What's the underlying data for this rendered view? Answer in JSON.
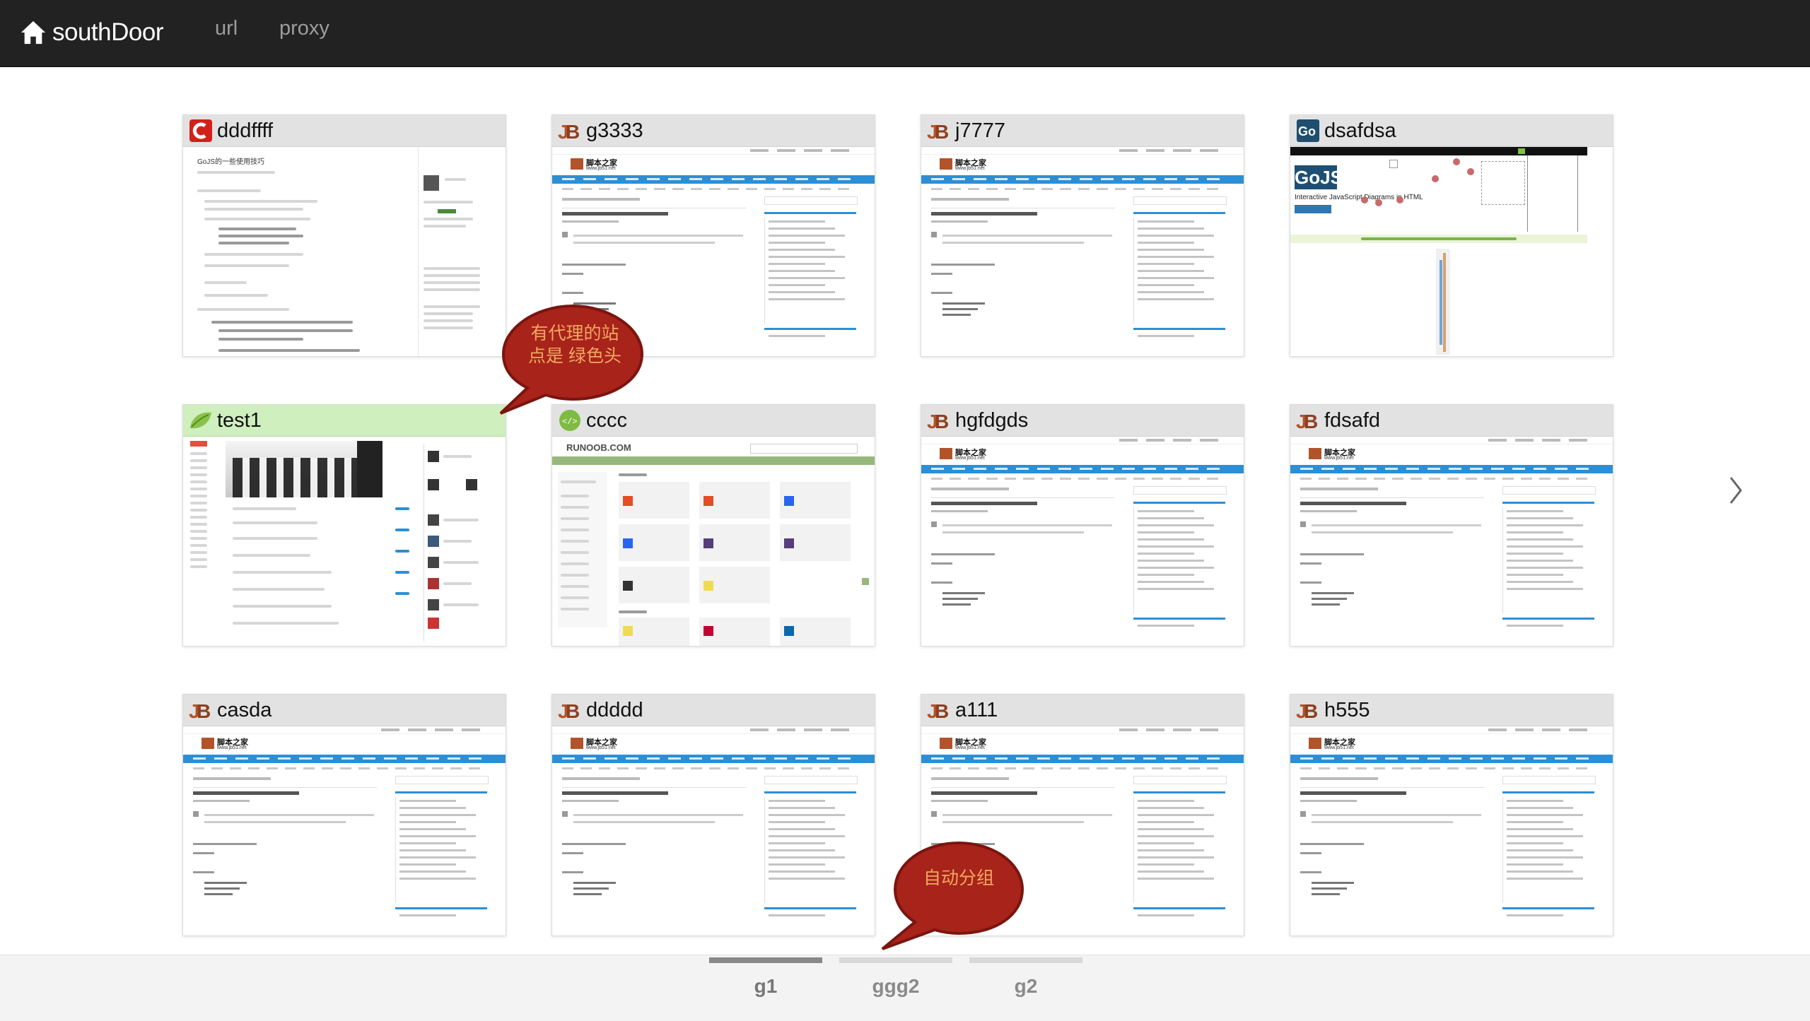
{
  "nav": {
    "brand": "southDoor",
    "links": [
      "url",
      "proxy"
    ]
  },
  "tiles": [
    {
      "title": "dddffff",
      "icon": "red-c-logo-icon",
      "proxy": false
    },
    {
      "title": "g3333",
      "icon": "jb51-logo-icon",
      "proxy": false
    },
    {
      "title": "j7777",
      "icon": "jb51-logo-icon",
      "proxy": false
    },
    {
      "title": "dsafdsa",
      "icon": "gojs-logo-icon",
      "proxy": false
    },
    {
      "title": "test1",
      "icon": "green-leaf-icon",
      "proxy": true
    },
    {
      "title": "cccc",
      "icon": "runoob-logo-icon",
      "proxy": false
    },
    {
      "title": "hgfdgds",
      "icon": "jb51-logo-icon",
      "proxy": false
    },
    {
      "title": "fdsafd",
      "icon": "jb51-logo-icon",
      "proxy": false
    },
    {
      "title": "casda",
      "icon": "jb51-logo-icon",
      "proxy": false
    },
    {
      "title": "ddddd",
      "icon": "jb51-logo-icon",
      "proxy": false
    },
    {
      "title": "a111",
      "icon": "jb51-logo-icon",
      "proxy": false
    },
    {
      "title": "h555",
      "icon": "jb51-logo-icon",
      "proxy": false
    }
  ],
  "callouts": {
    "proxy_note": [
      "有代理的站",
      "点是 绿色头"
    ],
    "group_note": "自动分组"
  },
  "thumb_text": {
    "jb51_site": "脚本之家",
    "jb51_url": "www.jb51.net",
    "gojs_logo": "GoJS",
    "gojs_tagline": "Interactive JavaScript Diagrams in HTML",
    "runoob_logo": "RUNOOB.COM",
    "cnblog_title": "GoJS的一些使用技巧"
  },
  "groups": [
    {
      "label": "g1",
      "active": true
    },
    {
      "label": "ggg2",
      "active": false
    },
    {
      "label": "g2",
      "active": false
    }
  ],
  "colors": {
    "navbar": "#222222",
    "proxy_header": "#cfefbf",
    "callout_fill": "#a8231a",
    "callout_text": "#f0a860"
  }
}
